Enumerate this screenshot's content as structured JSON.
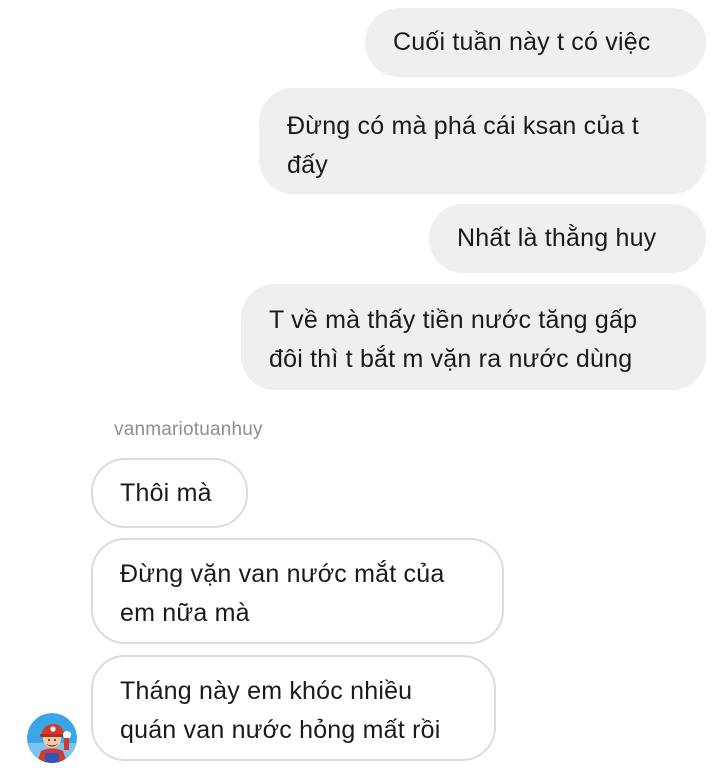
{
  "conversation": {
    "outgoing": [
      {
        "lines": [
          "Cuối tuần này t có việc"
        ]
      },
      {
        "lines": [
          "Đừng có mà phá cái ksan của t",
          "đấy"
        ]
      },
      {
        "lines": [
          "Nhất là thằng huy"
        ]
      },
      {
        "lines": [
          "T về mà thấy tiền nước tăng gấp",
          "đôi thì t bắt m vặn ra nước dùng"
        ]
      }
    ],
    "incoming": {
      "sender": "vanmariotuanhuy",
      "avatar_icon": "mario-avatar-icon",
      "messages": [
        {
          "lines": [
            "Thôi mà"
          ]
        },
        {
          "lines": [
            "Đừng vặn van nước mắt của",
            "em nữa mà"
          ]
        },
        {
          "lines": [
            "Tháng này em khóc nhiều",
            "quán van nước hỏng mất rồi"
          ]
        }
      ]
    }
  },
  "colors": {
    "outgoing_bubble": "#efefef",
    "incoming_border": "#dbdbdb",
    "sender_text": "#8e8e8e",
    "text": "#1a1a1a"
  }
}
